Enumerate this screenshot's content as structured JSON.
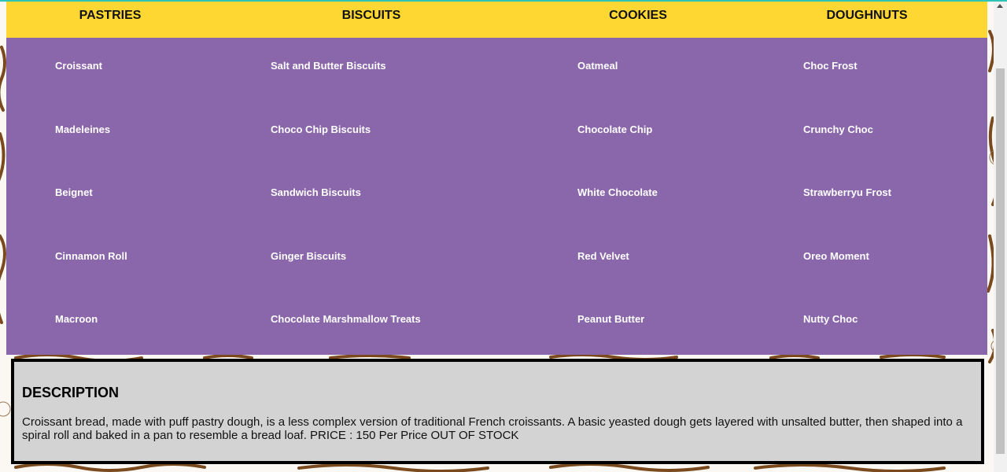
{
  "menu": {
    "columns": [
      {
        "title": "PASTRIES",
        "items": [
          "Croissant",
          "Madeleines",
          "Beignet",
          "Cinnamon Roll",
          "Macroon"
        ]
      },
      {
        "title": "BISCUITS",
        "items": [
          "Salt and Butter Biscuits",
          "Choco Chip Biscuits",
          "Sandwich Biscuits",
          "Ginger Biscuits",
          "Chocolate Marshmallow Treats"
        ]
      },
      {
        "title": "COOKIES",
        "items": [
          "Oatmeal",
          "Chocolate Chip",
          "White Chocolate",
          "Red Velvet",
          "Peanut Butter"
        ]
      },
      {
        "title": "DOUGHNUTS",
        "items": [
          "Choc Frost",
          "Crunchy Choc",
          "Strawberryu Frost",
          "Oreo Moment",
          "Nutty Choc"
        ]
      }
    ]
  },
  "description": {
    "title": "DESCRIPTION",
    "text": "Croissant bread, made with puff pastry dough, is a less complex version of traditional French croissants. A basic yeasted dough gets layered with unsalted butter, then shaped into a spiral roll and baked in a pan to resemble a bread loaf. PRICE : 150 Per Price OUT OF STOCK"
  },
  "colors": {
    "header": "#ffd732",
    "menu_background": "#8a66aa",
    "description_background": "#d3d3d3"
  },
  "icons": {
    "scrollbar_up": "triangle-up-icon"
  }
}
